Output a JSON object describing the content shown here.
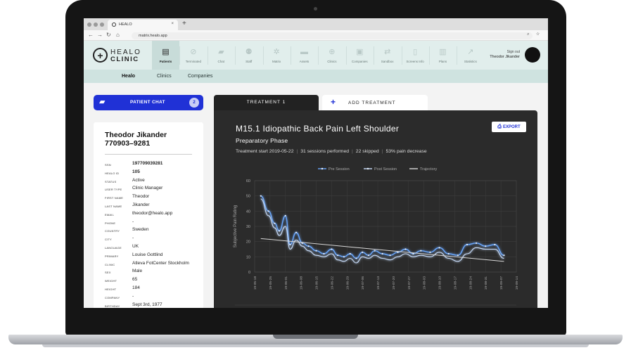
{
  "browser": {
    "tab_title": "HEALO",
    "tab_close": "×",
    "new_tab": "+",
    "url": "matrix.healo.app",
    "url_icons": "⌕ ☆"
  },
  "logo": {
    "line1": "HEALO",
    "line2": "CLINIC",
    "mark": "+"
  },
  "nav": {
    "items": [
      {
        "label": "Patients",
        "icon": "id-card-icon",
        "glyph": "▤"
      },
      {
        "label": "Terminated",
        "icon": "slash-circle-icon",
        "glyph": "⊘"
      },
      {
        "label": "Chat",
        "icon": "chat-bubbles-icon",
        "glyph": "▰"
      },
      {
        "label": "Staff",
        "icon": "people-icon",
        "glyph": "⚉"
      },
      {
        "label": "Matrix",
        "icon": "gear-icon",
        "glyph": "✲"
      },
      {
        "label": "Assets",
        "icon": "folder-icon",
        "glyph": "▬"
      },
      {
        "label": "Clinics",
        "icon": "plus-circle-icon",
        "glyph": "⊕"
      },
      {
        "label": "Companies",
        "icon": "briefcase-icon",
        "glyph": "▣"
      },
      {
        "label": "Sandbox",
        "icon": "swap-icon",
        "glyph": "⇄"
      },
      {
        "label": "Screens Info",
        "icon": "phone-icon",
        "glyph": "▯"
      },
      {
        "label": "Plans",
        "icon": "document-icon",
        "glyph": "▥"
      },
      {
        "label": "Statistics",
        "icon": "chart-line-icon",
        "glyph": "↗"
      }
    ],
    "signout_label": "Sign out",
    "user_name": "Theodor Jikander"
  },
  "subnav": {
    "items": [
      "Healo",
      "Clinics",
      "Companies"
    ]
  },
  "chat": {
    "label": "PATIENT CHAT",
    "badge": "2",
    "icon": "chat-bubbles-icon"
  },
  "patient": {
    "name": "Theodor Jikander",
    "id_number": "770903–9281",
    "fields": [
      {
        "key": "SSN",
        "value": "197709039281",
        "bold": true
      },
      {
        "key": "HEALO ID",
        "value": "105",
        "bold": true
      },
      {
        "key": "STATUS",
        "value": "Active"
      },
      {
        "key": "USER TYPE",
        "value": "Clinic Manager"
      },
      {
        "key": "FIRST NAME",
        "value": "Theodor"
      },
      {
        "key": "LAST NAME",
        "value": "Jikander"
      },
      {
        "key": "EMAIL",
        "value": "theodor@healo.app"
      },
      {
        "key": "PHONE",
        "value": "-"
      },
      {
        "key": "COUNTRY",
        "value": "Sweden"
      },
      {
        "key": "CITY",
        "value": "-"
      },
      {
        "key": "LANGUAGE",
        "value": "UK"
      },
      {
        "key": "PRIMARY",
        "value": "Louise Gottlind"
      },
      {
        "key": "CLINIC",
        "value": "Atleva FotCenter Stockholm"
      },
      {
        "key": "SEX",
        "value": "Male"
      },
      {
        "key": "WEIGHT",
        "value": "65"
      },
      {
        "key": "HEIGHT",
        "value": "184"
      },
      {
        "key": "COMPANY",
        "value": "-"
      },
      {
        "key": "BIRTHDAY",
        "value": "Sept 3rd, 1977"
      }
    ]
  },
  "treatment": {
    "tab_active": "TREATMENT 1",
    "tab_add": "ADD TREATMENT",
    "export_label": "EXPORT",
    "title": "M15.1 Idiopathic Back Pain Left Shoulder",
    "phase": "Preparatory Phase",
    "start": "Treatment start 2019-05-22",
    "sessions": "31 sessions performed",
    "skipped": "22 skipped",
    "decrease": "53% pain decrease",
    "colors": {
      "pre": "#6aa8ff",
      "post": "#c9defc",
      "trajectory": "#d9d9d9",
      "accent": "#2031d6"
    }
  },
  "chart_data": {
    "type": "line",
    "ylabel": "Subjective Pain Rating",
    "ylim": [
      0,
      60
    ],
    "yticks": [
      0,
      10,
      20,
      30,
      40,
      50,
      60
    ],
    "grid": true,
    "legend": "top",
    "categories": [
      "19-05-18",
      "19-05-25",
      "19-06-01",
      "19-06-08",
      "19-06-15",
      "19-06-22",
      "19-06-29",
      "19-07-06",
      "19-07-13",
      "19-07-20",
      "19-07-27",
      "19-08-03",
      "19-08-10",
      "19-08-17",
      "19-08-24",
      "19-08-31",
      "19-09-07",
      "19-09-14"
    ],
    "x_range": [
      0,
      17
    ],
    "series": [
      {
        "name": "Pre Session",
        "x": [
          0.4,
          0.9,
          1.3,
          1.6,
          2.0,
          2.3,
          2.7,
          3.1,
          3.5,
          4.0,
          4.5,
          5.0,
          5.4,
          5.8,
          6.2,
          6.6,
          7.0,
          7.4,
          7.8,
          8.3,
          8.8,
          9.3,
          9.8,
          10.3,
          10.8,
          11.4,
          12.0,
          12.6,
          13.2,
          13.8,
          14.4,
          15.0,
          15.6,
          16.2
        ],
        "values": [
          50,
          40,
          32,
          27,
          37,
          18,
          26,
          19,
          17,
          14,
          12,
          15,
          11,
          10,
          12,
          9,
          13,
          11,
          14,
          12,
          11,
          13,
          15,
          12,
          14,
          13,
          16,
          12,
          11,
          18,
          19,
          17,
          18,
          11
        ]
      },
      {
        "name": "Post Session",
        "x": [
          0.4,
          0.9,
          1.3,
          1.6,
          2.0,
          2.3,
          2.7,
          3.1,
          3.5,
          4.0,
          4.5,
          5.0,
          5.4,
          5.8,
          6.2,
          6.6,
          7.0,
          7.4,
          7.8,
          8.3,
          8.8,
          9.3,
          9.8,
          10.3,
          10.8,
          11.4,
          12.0,
          12.6,
          13.2,
          13.8,
          14.4,
          15.0,
          15.6,
          16.2
        ],
        "values": [
          48,
          37,
          29,
          24,
          30,
          15,
          21,
          17,
          14,
          11,
          10,
          12,
          8,
          7,
          9,
          6,
          10,
          9,
          11,
          9,
          8,
          10,
          12,
          10,
          11,
          10,
          13,
          9,
          7,
          12,
          16,
          15,
          15,
          9
        ]
      },
      {
        "name": "Trajectory",
        "x": [
          0.4,
          16.2
        ],
        "values": [
          22,
          7
        ]
      }
    ]
  }
}
